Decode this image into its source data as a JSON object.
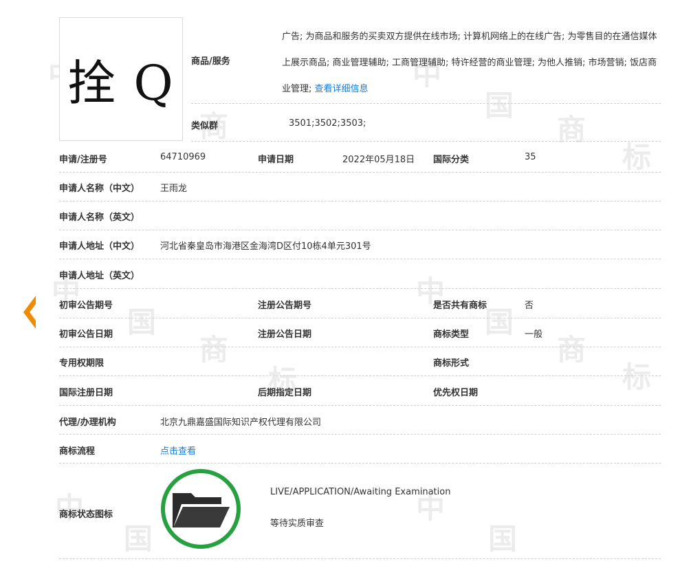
{
  "logo": {
    "text": "拴 Q"
  },
  "goods": {
    "label": "商品/服务",
    "text": "广告; 为商品和服务的买卖双方提供在线市场; 计算机网络上的在线广告; 为零售目的在通信媒体上展示商品; 商业管理辅助; 工商管理辅助; 特许经营的商业管理; 为他人推销; 市场营销; 饭店商业管理; ",
    "detail_link": "查看详细信息"
  },
  "similar": {
    "label": "类似群",
    "value": "3501;3502;3503;"
  },
  "app_no": {
    "label": "申请/注册号",
    "value": "64710969"
  },
  "app_date": {
    "label": "申请日期",
    "value": "2022年05月18日"
  },
  "intl_class": {
    "label": "国际分类",
    "value": "35"
  },
  "applicant_cn": {
    "label": "申请人名称（中文）",
    "value": "王雨龙"
  },
  "applicant_en": {
    "label": "申请人名称（英文）",
    "value": ""
  },
  "address_cn": {
    "label": "申请人地址（中文）",
    "value": "河北省秦皇岛市海港区金海湾D区付10栋4单元301号"
  },
  "address_en": {
    "label": "申请人地址（英文）",
    "value": ""
  },
  "prelim_issue": {
    "label": "初审公告期号",
    "value": ""
  },
  "reg_issue": {
    "label": "注册公告期号",
    "value": ""
  },
  "shared": {
    "label": "是否共有商标",
    "value": "否"
  },
  "prelim_date": {
    "label": "初审公告日期",
    "value": ""
  },
  "reg_date": {
    "label": "注册公告日期",
    "value": ""
  },
  "tm_type": {
    "label": "商标类型",
    "value": "一般"
  },
  "exclusive": {
    "label": "专用权期限",
    "value": ""
  },
  "tm_form": {
    "label": "商标形式",
    "value": ""
  },
  "intl_reg_date": {
    "label": "国际注册日期",
    "value": ""
  },
  "later_date": {
    "label": "后期指定日期",
    "value": ""
  },
  "priority_date": {
    "label": "优先权日期",
    "value": ""
  },
  "agent": {
    "label": "代理/办理机构",
    "value": "北京九鼎嘉盛国际知识产权代理有限公司"
  },
  "flow": {
    "label": "商标流程",
    "link": "点击查看"
  },
  "status": {
    "label": "商标状态图标",
    "english": "LIVE/APPLICATION/Awaiting Examination",
    "chinese": "等待实质审查",
    "ring_color": "#27a040"
  },
  "watermark": {
    "chars": [
      "中",
      "国",
      "商",
      "标"
    ]
  },
  "colors": {
    "link": "#1a7bd6",
    "accent_arrow": "#f08a00"
  }
}
